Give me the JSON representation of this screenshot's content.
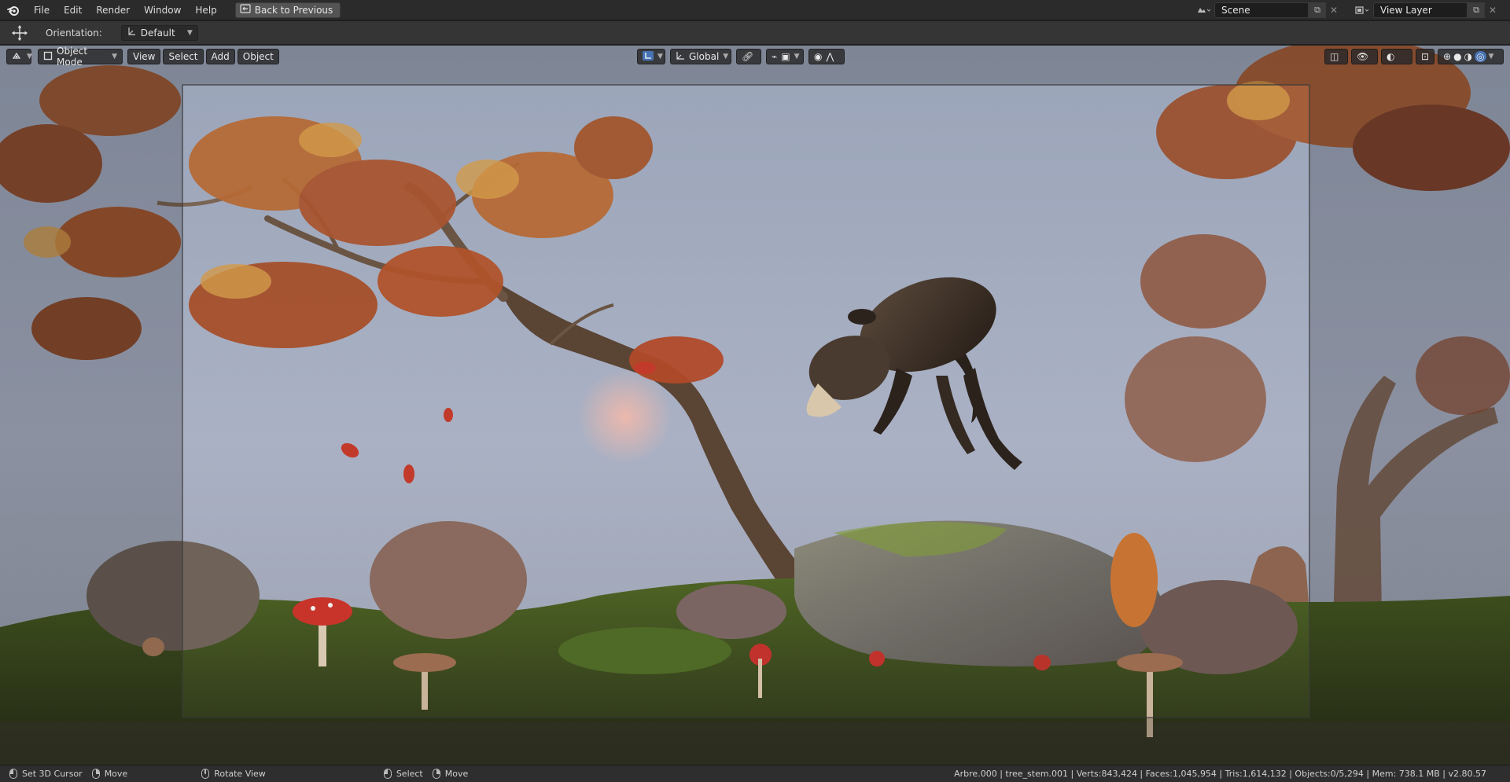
{
  "app": {
    "logo_icon": "blender-logo-icon"
  },
  "menu": {
    "items": [
      {
        "label": "File"
      },
      {
        "label": "Edit"
      },
      {
        "label": "Render"
      },
      {
        "label": "Window"
      },
      {
        "label": "Help"
      }
    ],
    "back_button": "Back to Previous"
  },
  "workspace": {
    "scene_label": "Scene",
    "view_layer_label": "View Layer"
  },
  "tool_settings": {
    "orientation_label": "Orientation:",
    "orientation_value": "Default"
  },
  "viewport_header": {
    "mode": "Object Mode",
    "menus": [
      "View",
      "Select",
      "Add",
      "Object"
    ],
    "transform_orientation": "Global"
  },
  "statusbar": {
    "left_action": "Set 3D Cursor",
    "left_action_2": "Move",
    "middle_action": "Rotate View",
    "select_action": "Select",
    "move_action": "Move",
    "stats": "Arbre.000 | tree_stem.001 | Verts:843,424 | Faces:1,045,954 | Tris:1,614,132 | Objects:0/5,294 | Mem: 738.1 MB | v2.80.57"
  },
  "colors": {
    "sky": "#a8b0c3",
    "accent": "#4772b3",
    "leaf_orange": "#b5542b",
    "moss": "#5d7a2d"
  }
}
